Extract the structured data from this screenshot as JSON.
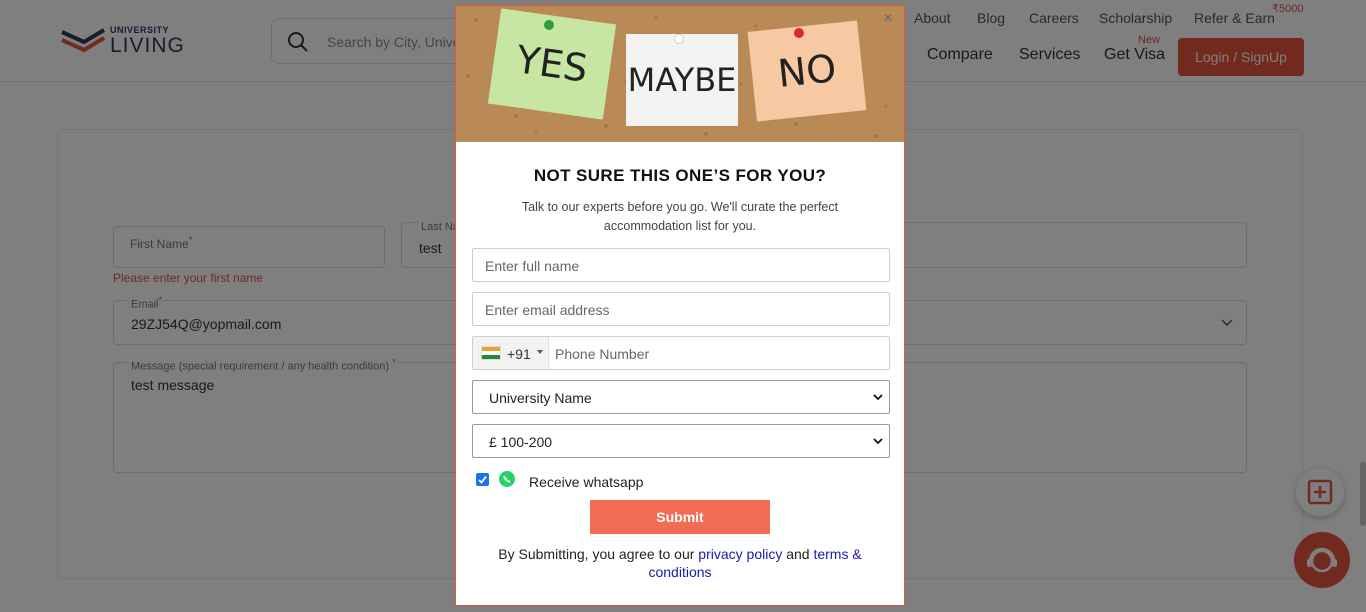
{
  "header": {
    "logo_small": "UNIVERSITY",
    "logo_big": "LIVING",
    "search_placeholder": "Search by City, Unive",
    "top_links": [
      "About",
      "Blog",
      "Careers",
      "Scholarship",
      "Refer & Earn"
    ],
    "refer_amount": "₹5000",
    "main_links": [
      "Compare",
      "Services",
      "Get Visa"
    ],
    "new_badge": "New",
    "login_label": "Login / SignUp"
  },
  "form": {
    "first_name_label": "First Name",
    "first_name_value": "",
    "first_name_error": "Please enter your first name",
    "last_name_label": "Last Na",
    "last_name_value": "test",
    "email_label": "Email",
    "email_value": "29ZJ54Q@yopmail.com",
    "message_label": "Message (special requirement / any health condition)",
    "message_value": "test message",
    "required_mark": "*"
  },
  "modal": {
    "notes": [
      "YES",
      "MAYBE",
      "NO"
    ],
    "close_icon": "×",
    "title": "NOT SURE THIS ONE’S FOR YOU?",
    "subtitle": "Talk to our experts before you go. We'll curate the perfect accommodation list for you.",
    "full_name_placeholder": "Enter full name",
    "email_placeholder": "Enter email address",
    "country_code": "+91",
    "phone_placeholder": "Phone Number",
    "university_select": "University Name",
    "budget_select": "£ 100-200",
    "whatsapp_checked": true,
    "whatsapp_label": "Receive whatsapp",
    "submit_label": "Submit",
    "terms_prefix": "By Submitting, you agree to our ",
    "privacy_link": "privacy policy",
    "terms_and": " and ",
    "terms_link_1": "terms &",
    "terms_link_2": "conditions"
  },
  "colors": {
    "brand_red": "#e5533d",
    "submit": "#f26b55",
    "link": "#1a1aa6",
    "cork": "#b98a55"
  }
}
